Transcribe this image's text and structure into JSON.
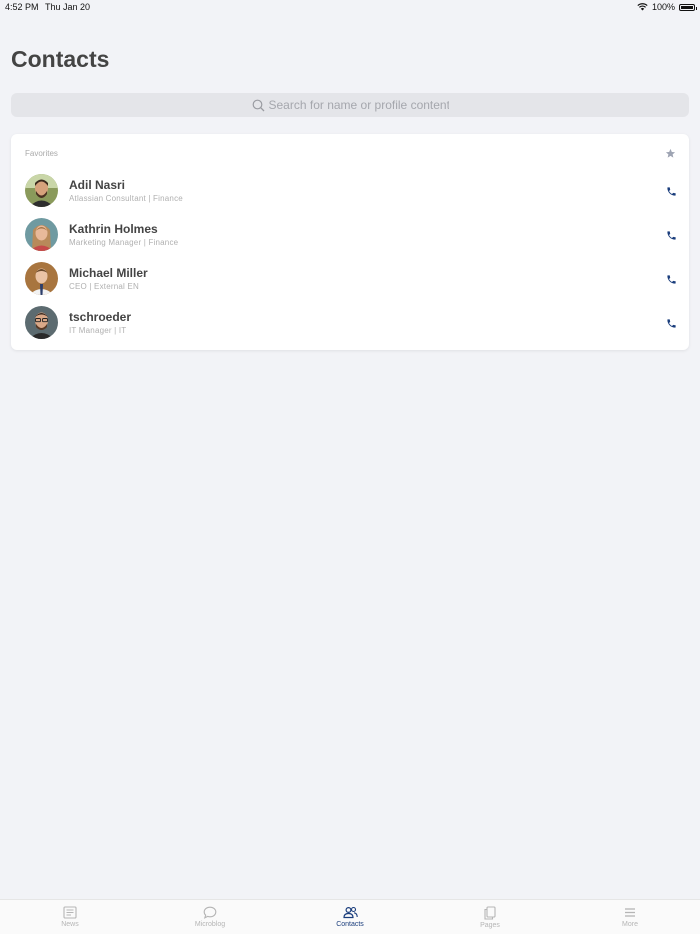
{
  "status_bar": {
    "time": "4:52 PM",
    "date": "Thu Jan 20",
    "battery": "100%",
    "battery_level": 1.0
  },
  "page": {
    "title": "Contacts"
  },
  "search": {
    "placeholder": "Search for name or profile content",
    "value": ""
  },
  "favorites": {
    "label": "Favorites",
    "contacts": [
      {
        "name": "Adil Nasri",
        "subtitle": "Atlassian Consultant | Finance"
      },
      {
        "name": "Kathrin Holmes",
        "subtitle": "Marketing Manager | Finance"
      },
      {
        "name": "Michael Miller",
        "subtitle": "CEO | External EN"
      },
      {
        "name": "tschroeder",
        "subtitle": "IT Manager | IT"
      }
    ]
  },
  "tabs": [
    {
      "label": "News",
      "icon": "news-icon",
      "active": false
    },
    {
      "label": "Microblog",
      "icon": "microblog-icon",
      "active": false
    },
    {
      "label": "Contacts",
      "icon": "contacts-icon",
      "active": true
    },
    {
      "label": "Pages",
      "icon": "pages-icon",
      "active": false
    },
    {
      "label": "More",
      "icon": "menu-icon",
      "active": false
    }
  ],
  "colors": {
    "accent": "#1a3d7c",
    "background": "#f2f3f7",
    "inactive_tab": "#b5b5b5"
  }
}
